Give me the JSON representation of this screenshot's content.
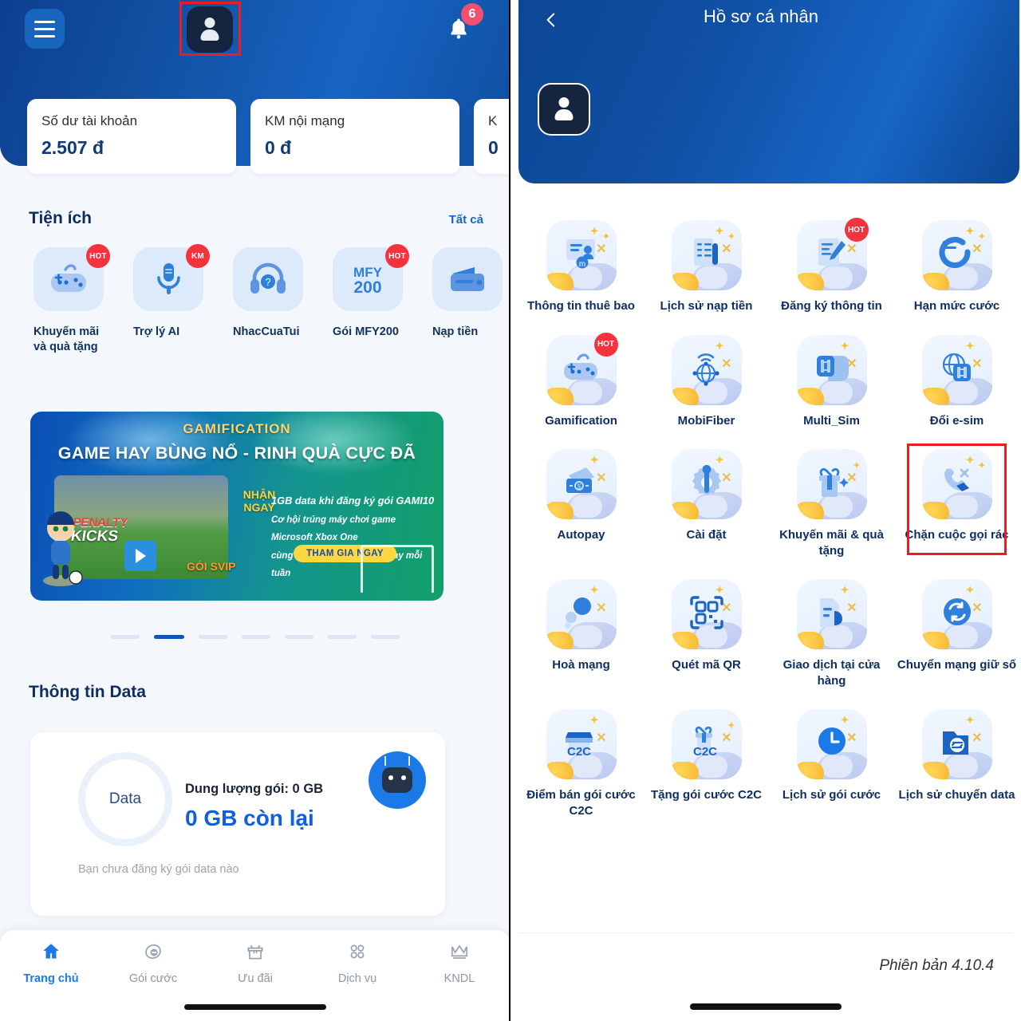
{
  "home": {
    "header": {
      "menu_icon": "hamburger-menu-icon",
      "avatar_icon": "user-avatar-icon",
      "bell_icon": "notification-bell-icon",
      "notification_count": "6"
    },
    "balance_cards": [
      {
        "label": "Số dư tài khoản",
        "value": "2.507 đ"
      },
      {
        "label": "KM nội mạng",
        "value": "0 đ"
      },
      {
        "label": "K",
        "value": "0"
      }
    ],
    "utilities_section": {
      "title": "Tiện ích",
      "see_all": "Tất cả",
      "items": [
        {
          "label": "Khuyến mãi và quà tặng",
          "badge": "HOT",
          "icon": "gamepad-icon"
        },
        {
          "label": "Trợ lý AI",
          "badge": "KM",
          "icon": "microphone-icon"
        },
        {
          "label": "NhacCuaTui",
          "badge": "",
          "icon": "headphones-icon"
        },
        {
          "label": "Gói MFY200",
          "badge": "HOT",
          "icon": "mfy200-icon"
        },
        {
          "label": "Nạp tiền",
          "badge": "",
          "icon": "wallet-icon"
        }
      ]
    },
    "banner": {
      "kicker": "GAMIFICATION",
      "title": "GAME HAY BÙNG NỔ - RINH QUÀ CỰC ĐÃ",
      "nhan_ngay": "NHẬN NGAY",
      "line1": "1GB data khi đăng ký gói GAMI10",
      "line2": "Cơ hội trúng máy chơi game Microsoft Xbox One",
      "line3": "cùng tài khoản SVIP FPT PLay mỗi tuần",
      "cta": "THAM GIA NGAY",
      "game_title_1": "PENALTY",
      "game_title_2": "KICKS",
      "svip": "GÓI SVIP",
      "dots_total": 7,
      "dot_active_index": 1
    },
    "data_section": {
      "title": "Thông tin Data",
      "ring_label": "Data",
      "capacity_label": "Dung lượng gói:  0 GB",
      "remaining": "0 GB còn lại",
      "note": "Bạn chưa đăng ký gói data nào",
      "assistant_icon": "robot-assistant-icon"
    },
    "bottom_nav": [
      {
        "label": "Trang chủ",
        "icon": "home-icon",
        "active": true
      },
      {
        "label": "Gói cước",
        "icon": "package-icon",
        "active": false
      },
      {
        "label": "Ưu đãi",
        "icon": "gift-icon",
        "active": false
      },
      {
        "label": "Dịch vụ",
        "icon": "grid-icon",
        "active": false
      },
      {
        "label": "KNDL",
        "icon": "crown-icon",
        "active": false
      }
    ]
  },
  "profile": {
    "title": "Hồ sơ cá nhân",
    "back_icon": "chevron-left-icon",
    "avatar_icon": "user-avatar-icon",
    "version": "Phiên bản 4.10.4",
    "grid": [
      {
        "label": "Thông tin thuê bao",
        "icon": "subscriber-info-icon",
        "badge": "",
        "highlight": false
      },
      {
        "label": "Lịch sử nạp tiền",
        "icon": "topup-history-icon",
        "badge": "",
        "highlight": false
      },
      {
        "label": "Đăng ký thông tin",
        "icon": "register-info-icon",
        "badge": "HOT",
        "highlight": false
      },
      {
        "label": "Hạn mức cước",
        "icon": "credit-limit-icon",
        "badge": "",
        "highlight": false
      },
      {
        "label": "Gamification",
        "icon": "gamepad-icon",
        "badge": "HOT",
        "highlight": false
      },
      {
        "label": "MobiFiber",
        "icon": "fiber-network-icon",
        "badge": "",
        "highlight": false
      },
      {
        "label": "Multi_Sim",
        "icon": "multi-sim-icon",
        "badge": "",
        "highlight": false
      },
      {
        "label": "Đổi e-sim",
        "icon": "esim-globe-icon",
        "badge": "",
        "highlight": false
      },
      {
        "label": "Autopay",
        "icon": "autopay-money-icon",
        "badge": "",
        "highlight": false
      },
      {
        "label": "Cài đặt",
        "icon": "settings-gear-icon",
        "badge": "",
        "highlight": false
      },
      {
        "label": "Khuyến mãi & quà tặng",
        "icon": "gift-promo-icon",
        "badge": "",
        "highlight": false
      },
      {
        "label": "Chặn cuộc gọi rác",
        "icon": "block-spam-call-icon",
        "badge": "",
        "highlight": true
      },
      {
        "label": "Hoà mạng",
        "icon": "join-network-icon",
        "badge": "",
        "highlight": false
      },
      {
        "label": "Quét mã QR",
        "icon": "qr-scan-icon",
        "badge": "",
        "highlight": false
      },
      {
        "label": "Giao dịch tại cửa hàng",
        "icon": "store-transaction-icon",
        "badge": "",
        "highlight": false
      },
      {
        "label": "Chuyển mạng giữ số",
        "icon": "number-portability-icon",
        "badge": "",
        "highlight": false
      },
      {
        "label": "Điểm bán gói cước C2C",
        "icon": "c2c-store-icon",
        "badge": "",
        "highlight": false
      },
      {
        "label": "Tặng gói cước C2C",
        "icon": "c2c-gift-icon",
        "badge": "",
        "highlight": false
      },
      {
        "label": "Lịch sử gói cước",
        "icon": "clock-history-icon",
        "badge": "",
        "highlight": false
      },
      {
        "label": "Lịch sử chuyển data",
        "icon": "data-transfer-history-icon",
        "badge": "",
        "highlight": false
      }
    ]
  },
  "colors": {
    "brand_blue": "#1255b8",
    "header_gradient_start": "#0c4795",
    "header_gradient_end": "#1666c6",
    "accent_red": "#ee1c22",
    "hot_badge": "#f4333d",
    "badge_pink": "#f2506e",
    "label_navy": "#0d2f61",
    "page_bg": "#f4f7fc"
  }
}
